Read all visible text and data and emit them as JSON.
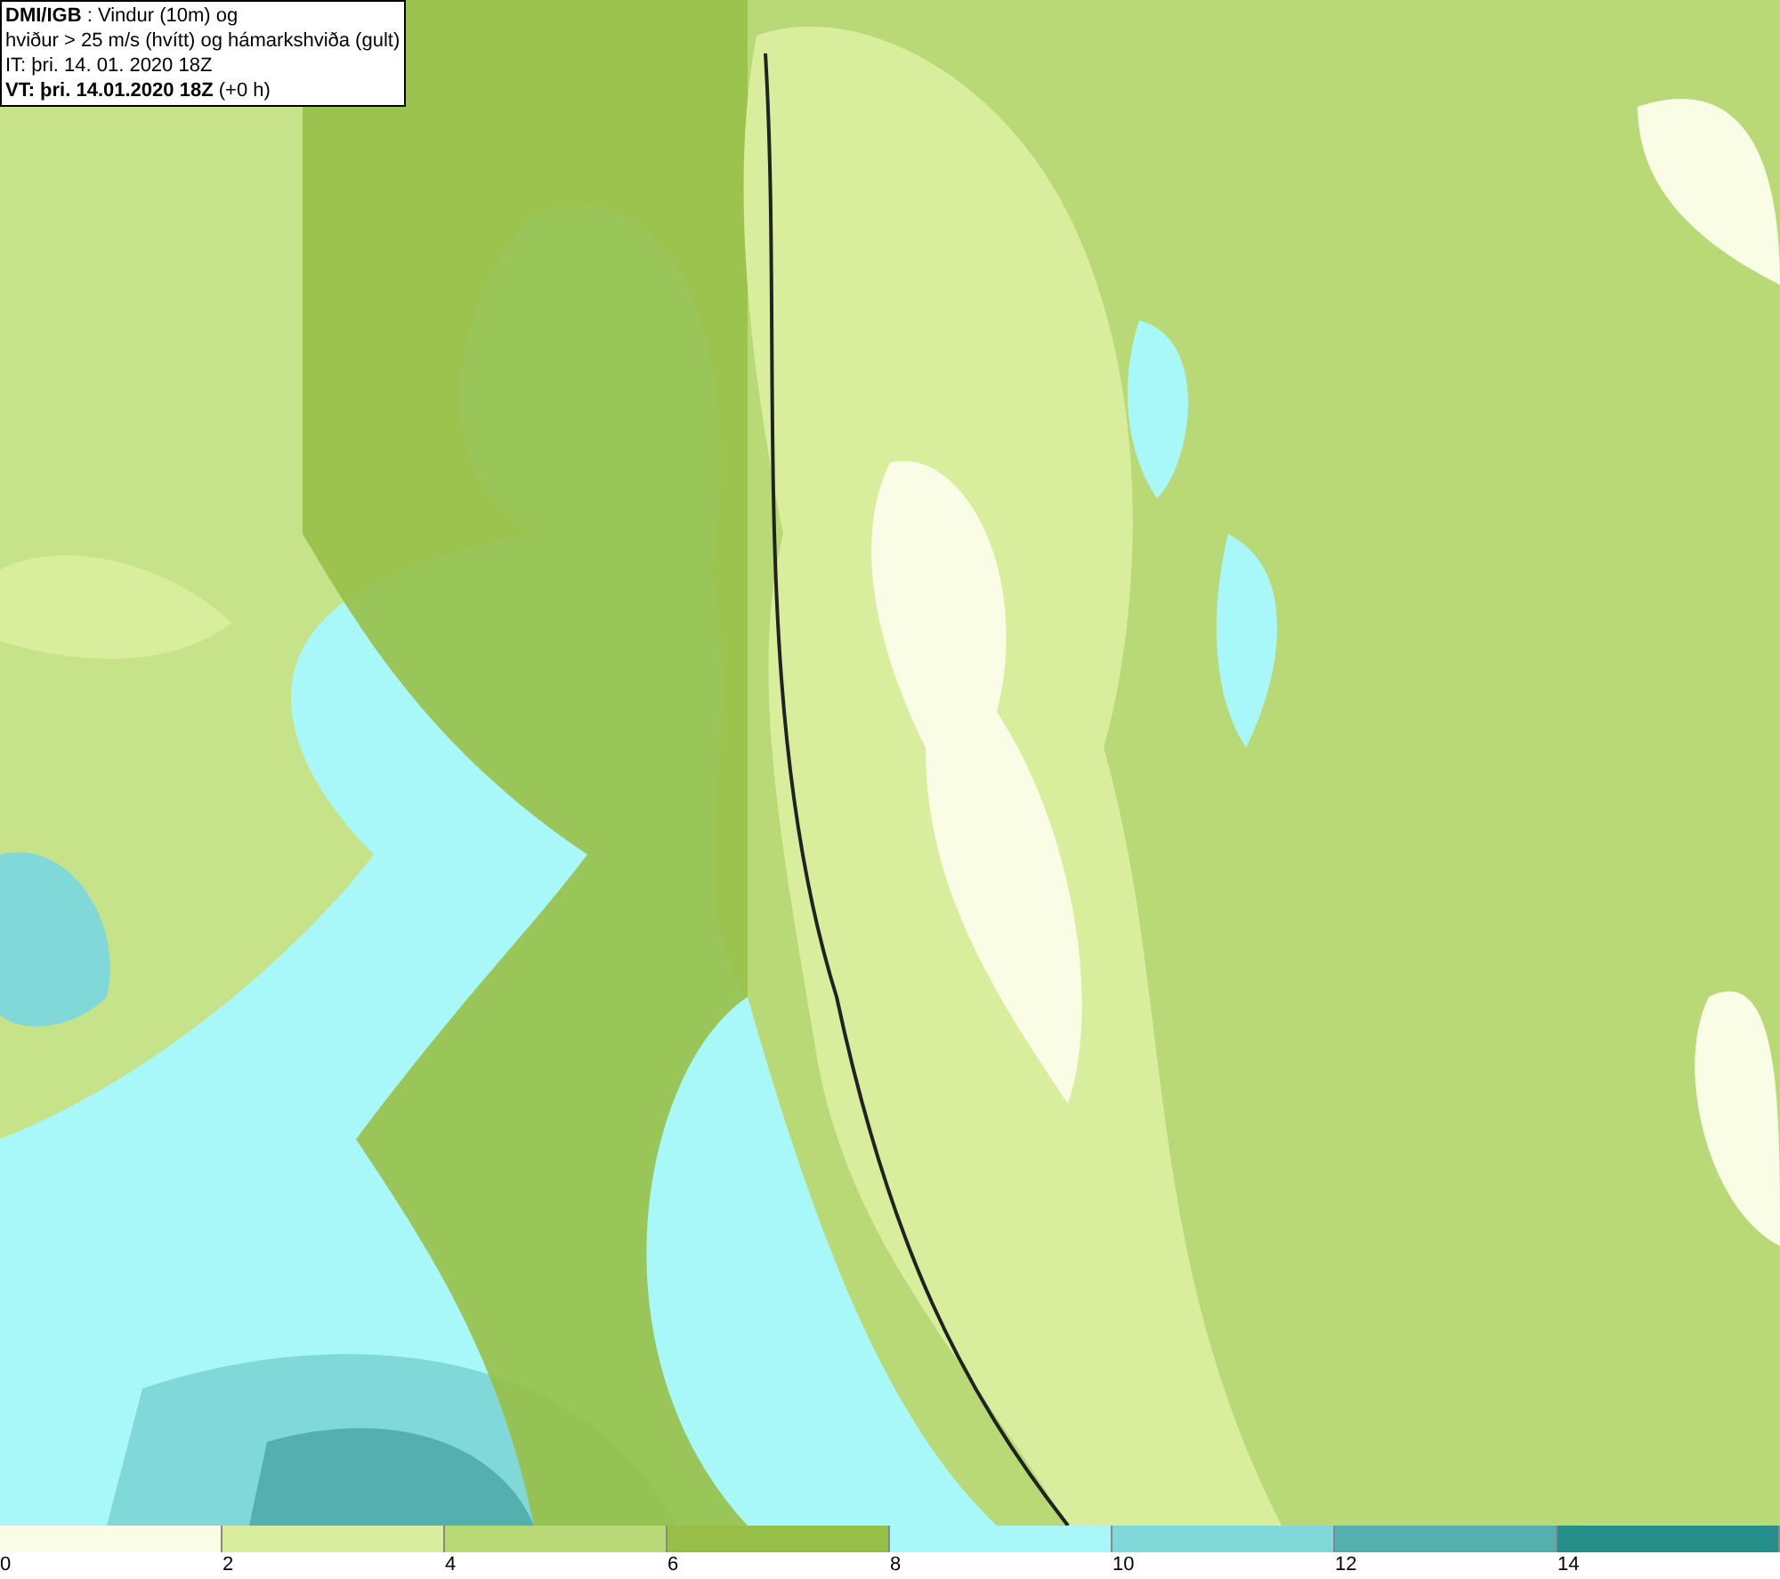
{
  "header": {
    "lines": [
      "**DMI/IGB** : Vindur (10m) og",
      "hviður > 25 m/s (hvítt) og hámarkshviða (gult)",
      "IT: þri. 14. 01. 2020 18Z",
      "**VT: þri. 14.01.2020 18Z** (+0 h)"
    ]
  },
  "colorbar": [
    {
      "label": "0",
      "color": "#fafde6"
    },
    {
      "label": "2",
      "color": "#d8ee9c"
    },
    {
      "label": "4",
      "color": "#b8d975"
    },
    {
      "label": "6",
      "color": "#97bf47"
    },
    {
      "label": "8",
      "color": "#a8f8fa"
    },
    {
      "label": "10",
      "color": "#80d8d8"
    },
    {
      "label": "12",
      "color": "#53b0ae"
    },
    {
      "label": "14",
      "color": "#25908a"
    }
  ]
}
